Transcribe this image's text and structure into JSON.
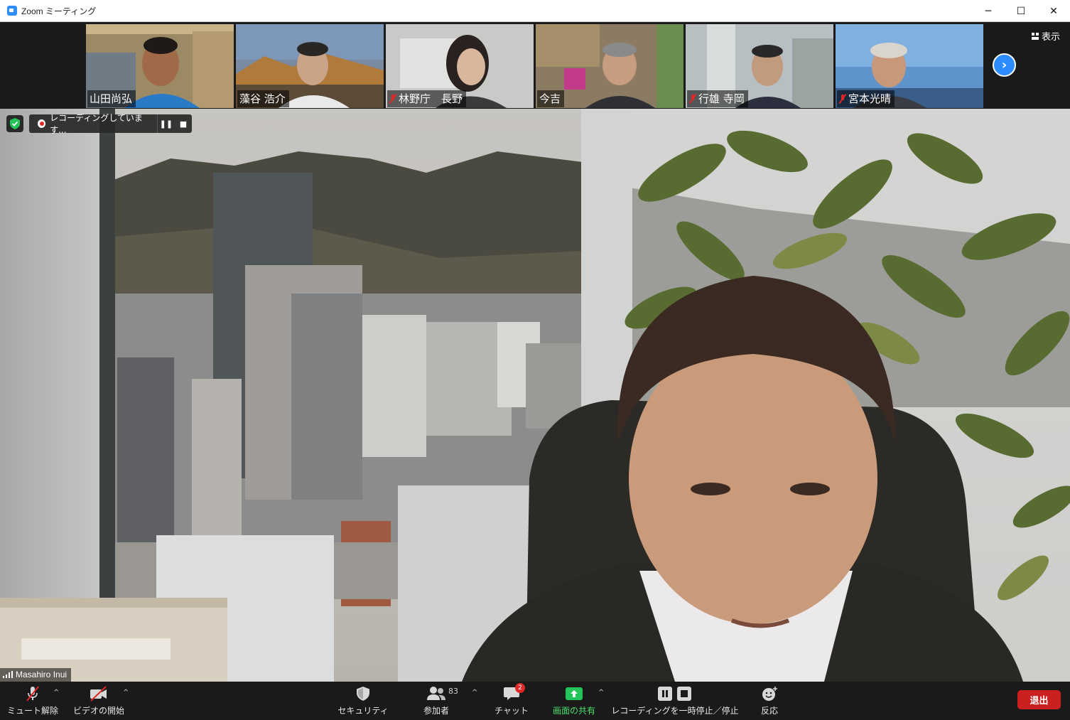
{
  "window": {
    "title": "Zoom ミーティング",
    "minimize_label": "─",
    "maximize_label": "☐",
    "close_label": "✕"
  },
  "strip": {
    "view_label": "表示",
    "next_label": "›",
    "participants": [
      {
        "name": "山田尚弘",
        "muted": false,
        "bg": "#9b8a64"
      },
      {
        "name": "藻谷 浩介",
        "muted": false,
        "bg": "#b07a3a"
      },
      {
        "name": "林野庁　長野",
        "muted": true,
        "bg": "#c9c9c7"
      },
      {
        "name": "今吉",
        "muted": false,
        "bg": "#8a7b62"
      },
      {
        "name": "行雄 寺岡",
        "muted": true,
        "bg": "#b8bfc2"
      },
      {
        "name": "宮本光晴",
        "muted": true,
        "bg": "#5f93cc"
      }
    ]
  },
  "main": {
    "speaker_name": "Masahiro Inui",
    "recording_text": "レコーディングしています...",
    "rec_pause_label": "❚❚",
    "rec_stop_label": "■"
  },
  "toolbar": {
    "mute_label": "ミュート解除",
    "video_label": "ビデオの開始",
    "security_label": "セキュリティ",
    "participants_label": "参加者",
    "participants_count": "83",
    "chat_label": "チャット",
    "chat_badge": "2",
    "share_label": "画面の共有",
    "recording_label": "レコーディングを一時停止／停止",
    "reactions_label": "反応",
    "leave_label": "退出",
    "caret": "^"
  },
  "colors": {
    "accent": "#2d8cff",
    "share_green": "#4ae06a",
    "leave_red": "#cc2020",
    "muted_red": "#e02828"
  }
}
